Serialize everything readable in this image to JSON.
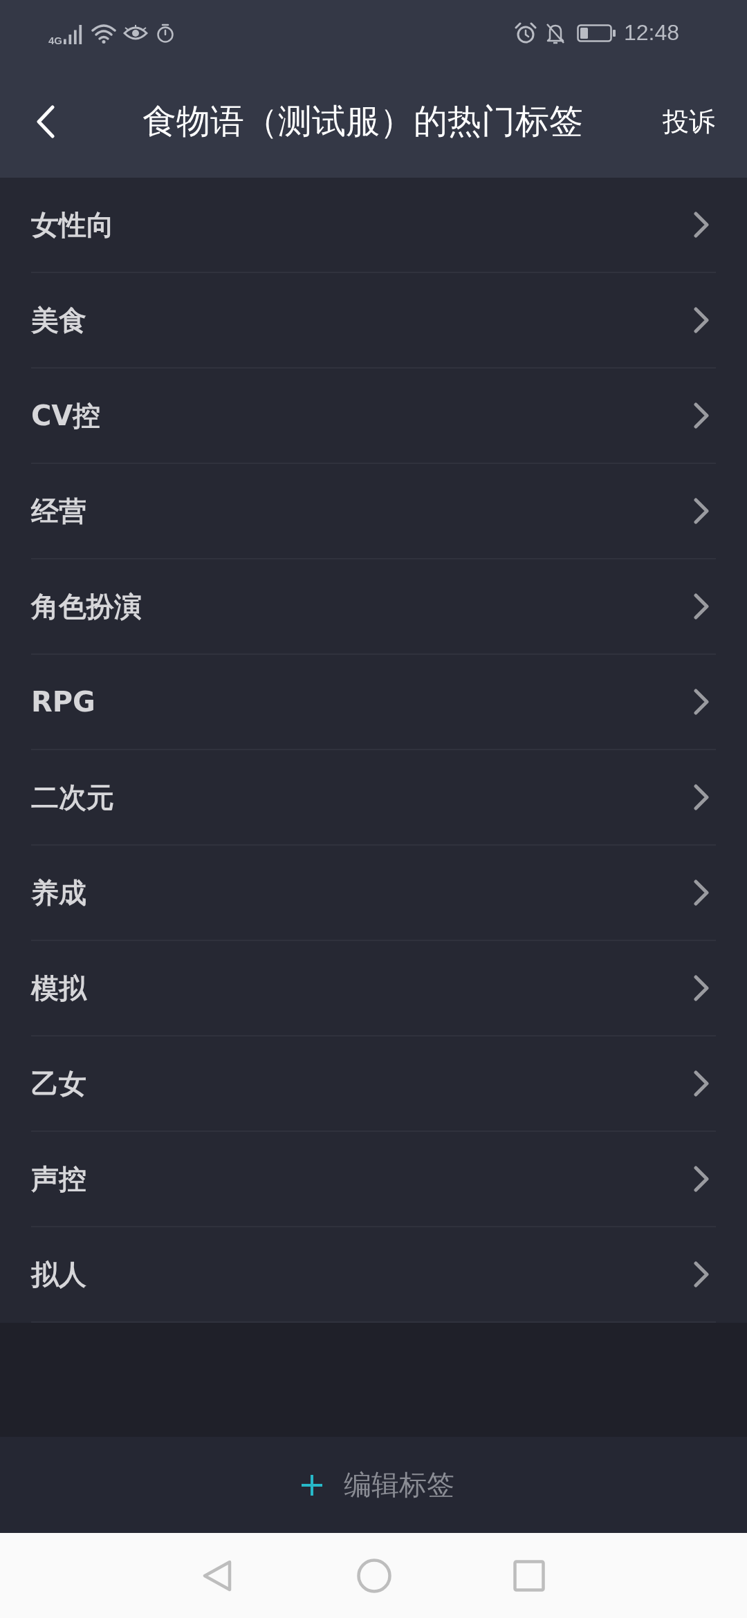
{
  "status_bar": {
    "network": "4G",
    "time": "12:48"
  },
  "header": {
    "title": "食物语（测试服）的热门标签",
    "action": "投诉"
  },
  "tags": [
    {
      "label": "女性向"
    },
    {
      "label": "美食"
    },
    {
      "label": "CV控"
    },
    {
      "label": "经营"
    },
    {
      "label": "角色扮演"
    },
    {
      "label": "RPG"
    },
    {
      "label": "二次元"
    },
    {
      "label": "养成"
    },
    {
      "label": "模拟"
    },
    {
      "label": "乙女"
    },
    {
      "label": "声控"
    },
    {
      "label": "拟人"
    }
  ],
  "edit_button": {
    "label": "编辑标签"
  }
}
